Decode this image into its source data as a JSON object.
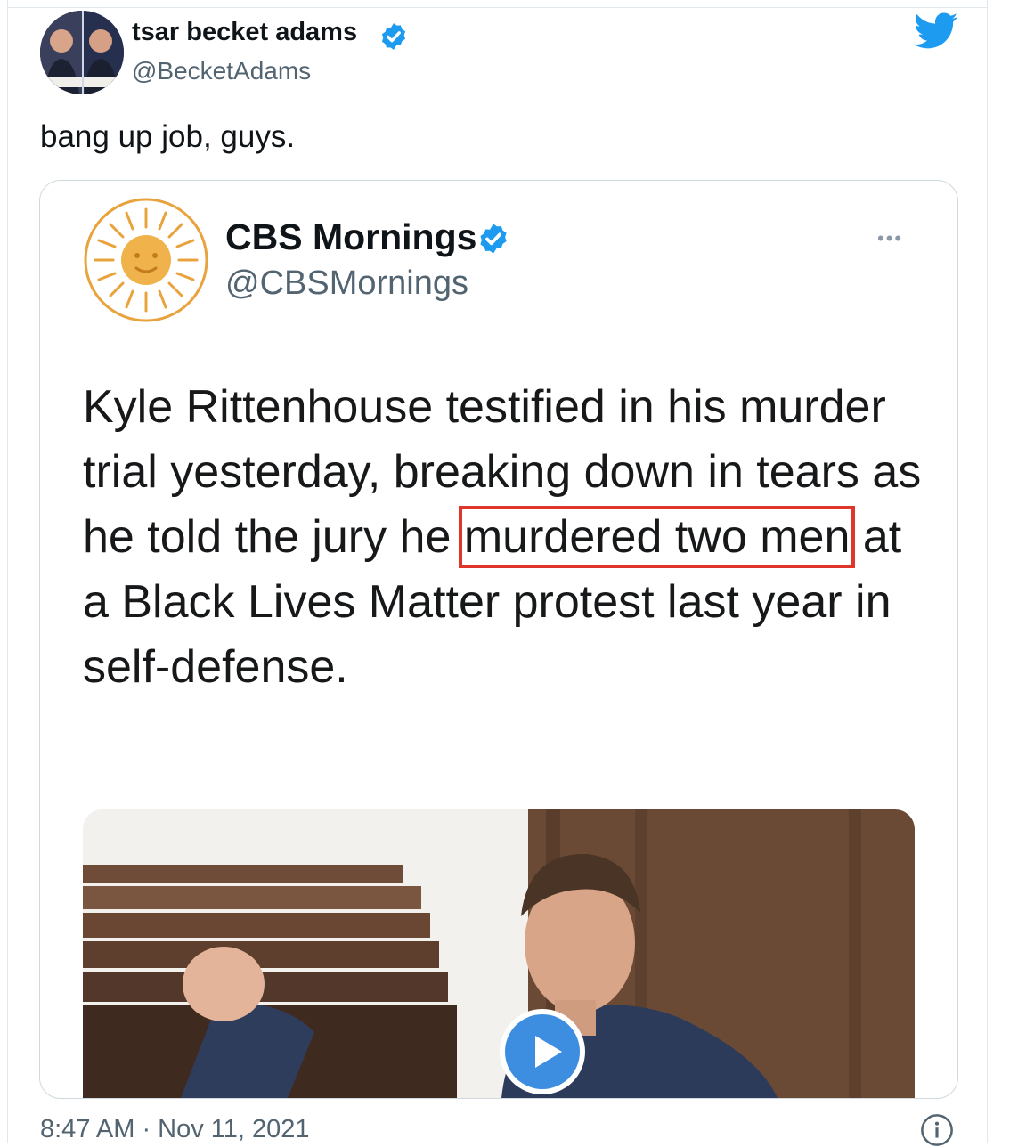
{
  "tweet": {
    "author_name": "tsar becket adams",
    "author_handle": "@BecketAdams",
    "text": "bang up job, guys.",
    "timestamp": "8:47 AM · Nov 11, 2021",
    "icons": [
      "avatar",
      "verified-badge-icon",
      "twitter-bird-icon",
      "info-icon"
    ]
  },
  "quoted_tweet": {
    "author_name": "CBS Mornings",
    "author_handle": "@CBSMornings",
    "more_label": "•••",
    "text_before": "Kyle Rittenhouse testified in his murder trial yesterday, breaking down in tears as he told the jury he ",
    "text_highlighted": "murdered two men",
    "text_after": " at a Black Lives Matter protest last year in self-defense.",
    "media": {
      "type": "video",
      "icon": "play-icon"
    },
    "highlight_color": "#e0352b"
  },
  "colors": {
    "verified": "#1d9bf0",
    "twitter_blue": "#1d9bf0",
    "secondary_text": "#536471",
    "play_button": "#3d8ee0",
    "cbs_gold": "#e8a33d"
  }
}
